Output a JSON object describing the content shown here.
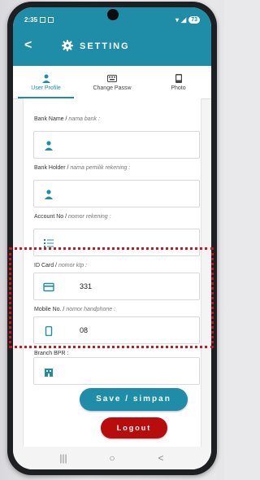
{
  "status": {
    "time": "2:35",
    "battery": "73"
  },
  "header": {
    "back_glyph": "<",
    "title": "SETTING"
  },
  "tabs": [
    {
      "label": "User Profile",
      "icon": "person-icon",
      "active": true
    },
    {
      "label": "Change Passw",
      "icon": "keyboard-icon",
      "active": false
    },
    {
      "label": "Photo",
      "icon": "phone-card-icon",
      "active": false
    }
  ],
  "form": {
    "bank_name": {
      "label": "Bank Name /",
      "hint": "nama bank :",
      "value": ""
    },
    "bank_holder": {
      "label": "Bank Holder /",
      "hint": "nama pemilik rekening :",
      "value": ""
    },
    "account_no": {
      "label": "Account No /",
      "hint": "nomor rekening :",
      "value": ""
    },
    "id_card": {
      "label": "ID Card /",
      "hint": "nomor ktp :",
      "value": "331"
    },
    "mobile_no": {
      "label": "Mobile No. /",
      "hint": "nomor handphone :",
      "value": "08"
    },
    "branch": {
      "label": "Branch BPR :",
      "value": ""
    }
  },
  "buttons": {
    "save": "Save / simpan",
    "logout": "Logout"
  },
  "navbar": {
    "recent": "|||",
    "home": "○",
    "back": "<"
  },
  "colors": {
    "primary": "#1f8da7",
    "logout": "#b80d0d",
    "highlight": "#d4121a"
  }
}
